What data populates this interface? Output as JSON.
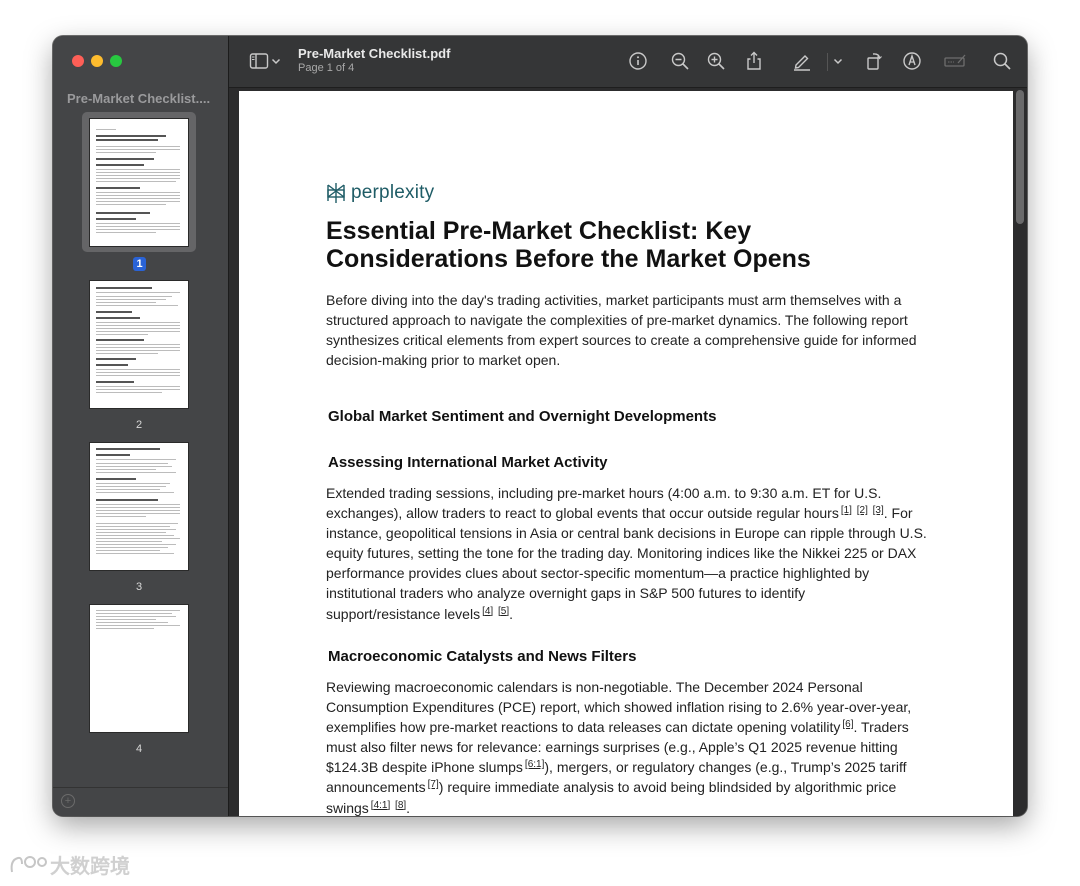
{
  "window": {
    "file_name": "Pre-Market Checklist.pdf",
    "page_indicator": "Page 1 of 4"
  },
  "sidebar": {
    "title": "Pre-Market Checklist....",
    "pages": [
      {
        "number": "1",
        "selected": true
      },
      {
        "number": "2",
        "selected": false
      },
      {
        "number": "3",
        "selected": false
      },
      {
        "number": "4",
        "selected": false
      }
    ]
  },
  "toolbar": {
    "icons": [
      "sidebar-toggle-icon",
      "chevron-down-icon",
      "info-icon",
      "zoom-out-icon",
      "zoom-in-icon",
      "share-icon",
      "highlight-pen-icon",
      "chevron-down-icon",
      "rotate-icon",
      "markup-icon",
      "form-fill-icon",
      "search-icon"
    ]
  },
  "document": {
    "logo_text": "perplexity",
    "title_line1": "Essential Pre-Market Checklist: Key",
    "title_line2": "Considerations Before the Market Opens",
    "intro_lines": [
      "Before diving into the day's trading activities, market participants must arm themselves with a",
      "structured approach to navigate the complexities of pre-market dynamics. The following report",
      "synthesizes critical elements from expert sources to create a comprehensive guide for informed",
      "decision-making prior to market open."
    ],
    "section1_heading": "Global Market Sentiment and Overnight Developments",
    "section1a_heading": "Assessing International Market Activity",
    "section1a_lines": [
      "Extended trading sessions, including pre-market hours (4:00 a.m. to 9:30 a.m. ET for U.S.",
      "exchanges), allow traders to react to global events that occur outside regular hours",
      ". For",
      "instance, geopolitical tensions in Asia or central bank decisions in Europe can ripple through U.S.",
      "equity futures, setting the tone for the trading day. Monitoring indices like the Nikkei 225 or DAX",
      "performance provides clues about sector-specific momentum—a practice highlighted by",
      "institutional traders who analyze overnight gaps in S&P 500 futures to identify",
      "support/resistance levels",
      "."
    ],
    "section1a_cites": [
      "[1]",
      "[2]",
      "[3]",
      "[4]",
      "[5]"
    ],
    "section1b_heading": "Macroeconomic Catalysts and News Filters",
    "section1b_lines": [
      "Reviewing macroeconomic calendars is non-negotiable. The December 2024 Personal",
      "Consumption Expenditures (PCE) report, which showed inflation rising to 2.6% year-over-year,",
      "exemplifies how pre-market reactions to data releases can dictate opening volatility",
      ". Traders",
      "must also filter news for relevance: earnings surprises (e.g., Apple’s Q1 2025 revenue hitting",
      "$124.3B despite iPhone slumps",
      "), mergers, or regulatory changes (e.g., Trump’s 2025 tariff",
      "announcements",
      ") require immediate analysis to avoid being blindsided by algorithmic price",
      "swings",
      "."
    ],
    "section1b_cites": [
      "[6]",
      "[6:1]",
      "[7]",
      "[4:1]",
      "[8]"
    ]
  },
  "watermark": "大数跨境"
}
